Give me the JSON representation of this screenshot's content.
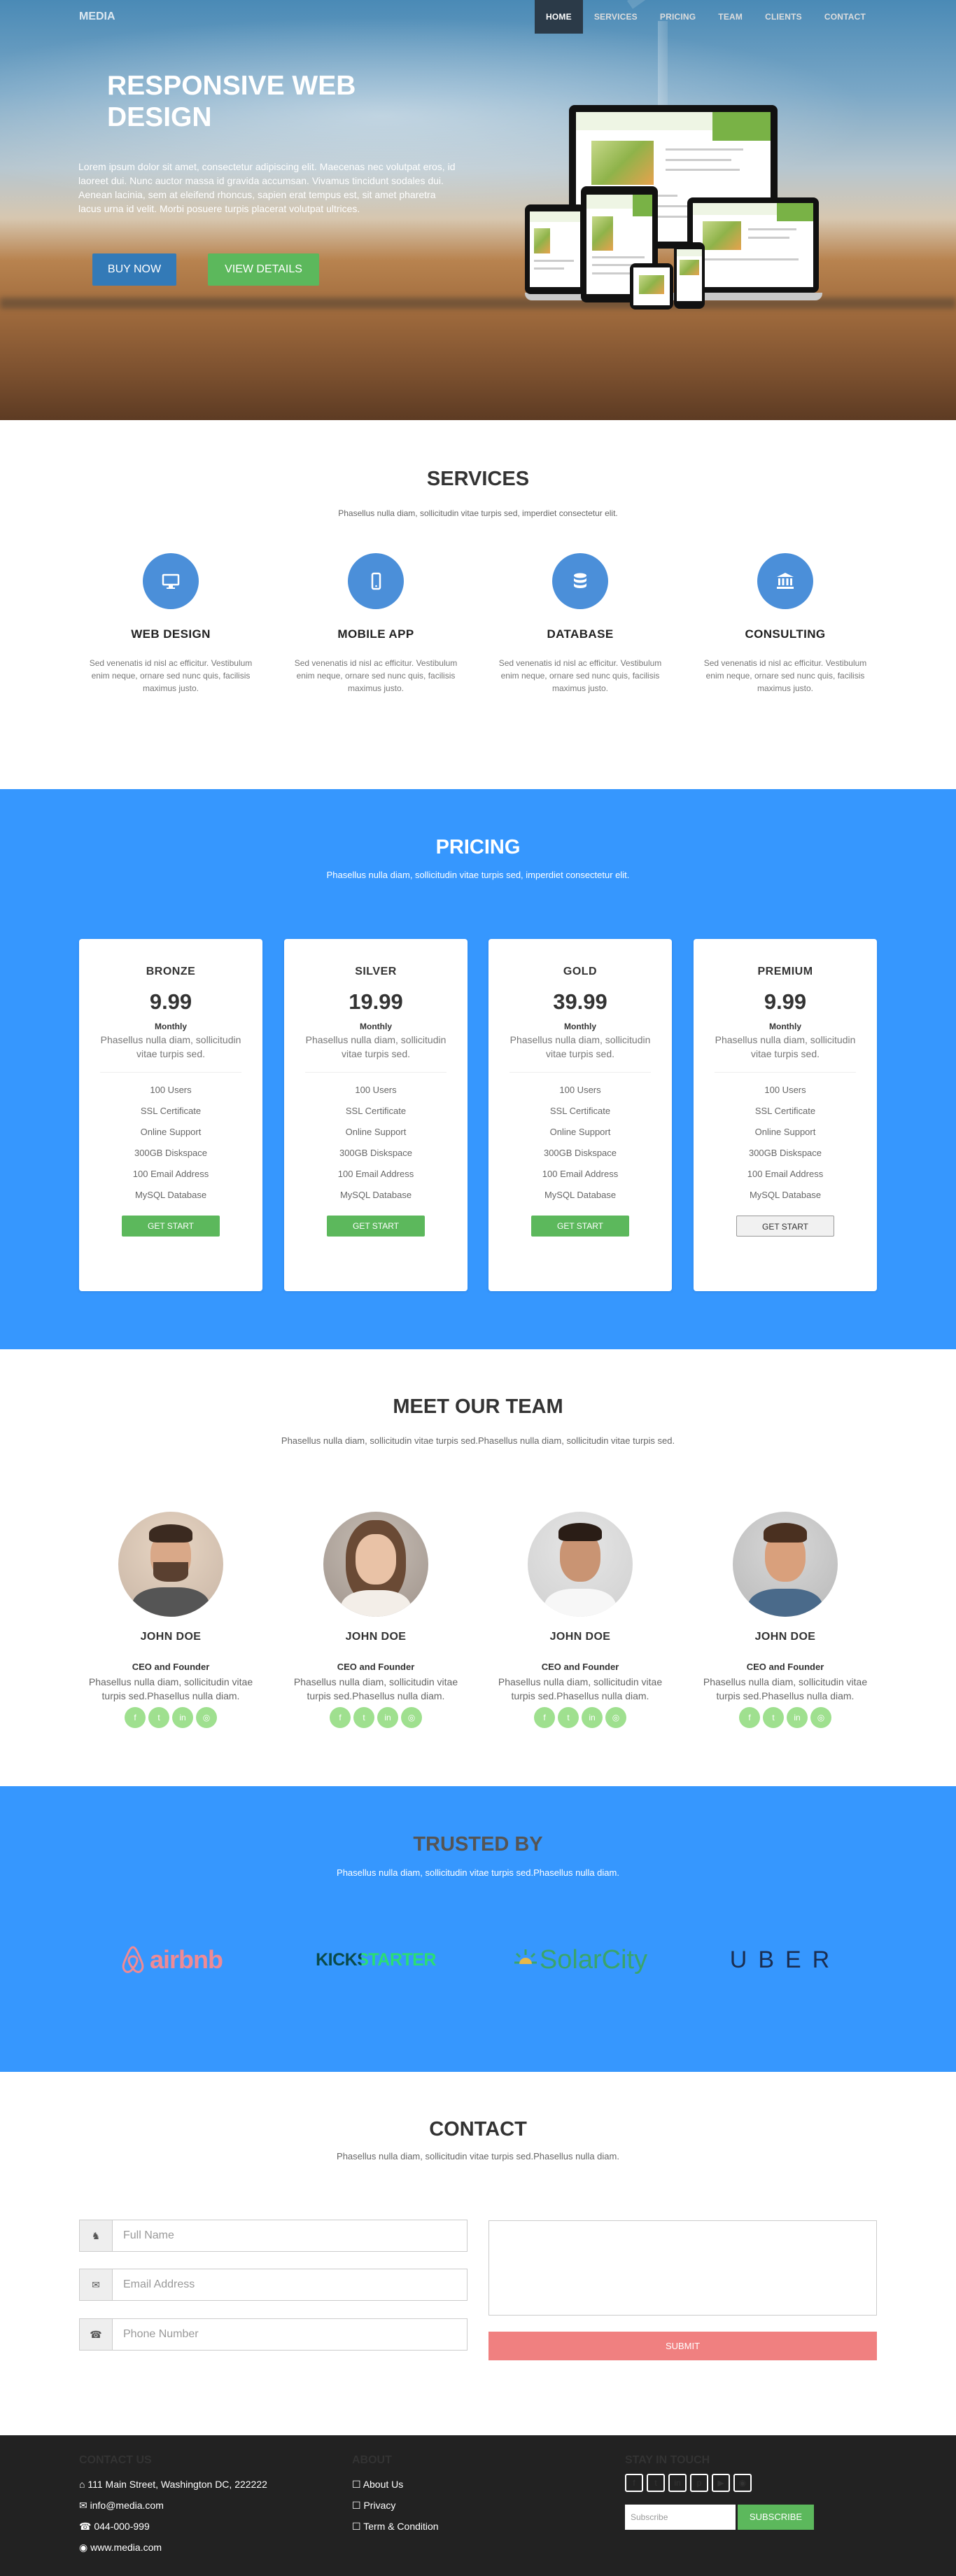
{
  "nav": {
    "brand": "MEDIA",
    "items": [
      "HOME",
      "SERVICES",
      "PRICING",
      "TEAM",
      "CLIENTS",
      "CONTACT"
    ]
  },
  "hero": {
    "title": "RESPONSIVE WEB DESIGN",
    "text": "Lorem ipsum dolor sit amet, consectetur adipiscing elit. Maecenas nec volutpat eros, id laoreet dui. Nunc auctor massa id gravida accumsan. Vivamus tincidunt sodales dui. Aenean lacinia, sem at eleifend rhoncus, sapien erat tempus est, sit amet pharetra lacus urna id velit. Morbi posuere turpis placerat volutpat ultrices.",
    "buy_label": "BUY NOW",
    "view_label": "VIEW DETAILS"
  },
  "services": {
    "title": "SERVICES",
    "subtitle": "Phasellus nulla diam, sollicitudin vitae turpis sed, imperdiet consectetur elit.",
    "items": [
      {
        "icon": "monitor-icon",
        "title": "WEB DESIGN",
        "text": "Sed venenatis id nisl ac efficitur. Vestibulum enim neque, ornare sed nunc quis, facilisis maximus justo."
      },
      {
        "icon": "mobile-icon",
        "title": "MOBILE APP",
        "text": "Sed venenatis id nisl ac efficitur. Vestibulum enim neque, ornare sed nunc quis, facilisis maximus justo."
      },
      {
        "icon": "database-icon",
        "title": "DATABASE",
        "text": "Sed venenatis id nisl ac efficitur. Vestibulum enim neque, ornare sed nunc quis, facilisis maximus justo."
      },
      {
        "icon": "bank-icon",
        "title": "CONSULTING",
        "text": "Sed venenatis id nisl ac efficitur. Vestibulum enim neque, ornare sed nunc quis, facilisis maximus justo."
      }
    ]
  },
  "pricing": {
    "title": "PRICING",
    "subtitle": "Phasellus nulla diam, sollicitudin vitae turpis sed, imperdiet consectetur elit.",
    "plans": [
      {
        "name": "BRONZE",
        "price": "9.99",
        "period": "Monthly",
        "desc": "Phasellus nulla diam, sollicitudin vitae turpis sed.",
        "features": [
          "100 Users",
          "SSL Certificate",
          "Online Support",
          "300GB Diskspace",
          "100 Email Address",
          "MySQL Database"
        ],
        "button": "GET START"
      },
      {
        "name": "SILVER",
        "price": "19.99",
        "period": "Monthly",
        "desc": "Phasellus nulla diam, sollicitudin vitae turpis sed.",
        "features": [
          "100 Users",
          "SSL Certificate",
          "Online Support",
          "300GB Diskspace",
          "100 Email Address",
          "MySQL Database"
        ],
        "button": "GET START"
      },
      {
        "name": "GOLD",
        "price": "39.99",
        "period": "Monthly",
        "desc": "Phasellus nulla diam, sollicitudin vitae turpis sed.",
        "features": [
          "100 Users",
          "SSL Certificate",
          "Online Support",
          "300GB Diskspace",
          "100 Email Address",
          "MySQL Database"
        ],
        "button": "GET START"
      },
      {
        "name": "PREMIUM",
        "price": "9.99",
        "period": "Monthly",
        "desc": "Phasellus nulla diam, sollicitudin vitae turpis sed.",
        "features": [
          "100 Users",
          "SSL Certificate",
          "Online Support",
          "300GB Diskspace",
          "100 Email Address",
          "MySQL Database"
        ],
        "button": "GET START"
      }
    ]
  },
  "team": {
    "title": "MEET OUR TEAM",
    "subtitle": "Phasellus nulla diam, sollicitudin vitae turpis sed.Phasellus nulla diam, sollicitudin vitae turpis sed.",
    "members": [
      {
        "name": "JOHN DOE",
        "role": "CEO and Founder",
        "bio": "Phasellus nulla diam, sollicitudin vitae turpis sed.Phasellus nulla diam."
      },
      {
        "name": "JOHN DOE",
        "role": "CEO and Founder",
        "bio": "Phasellus nulla diam, sollicitudin vitae turpis sed.Phasellus nulla diam."
      },
      {
        "name": "JOHN DOE",
        "role": "CEO and Founder",
        "bio": "Phasellus nulla diam, sollicitudin vitae turpis sed.Phasellus nulla diam."
      },
      {
        "name": "JOHN DOE",
        "role": "CEO and Founder",
        "bio": "Phasellus nulla diam, sollicitudin vitae turpis sed.Phasellus nulla diam."
      }
    ],
    "social_icons": [
      "facebook-icon",
      "twitter-icon",
      "linkedin-icon",
      "dribbble-icon"
    ]
  },
  "trusted": {
    "title": "TRUSTED BY",
    "subtitle": "Phasellus nulla diam, sollicitudin vitae turpis sed.Phasellus nulla diam.",
    "logos": [
      "airbnb",
      "KICKSTARTER",
      "SolarCity",
      "UBER"
    ]
  },
  "contact": {
    "title": "CONTACT",
    "subtitle": "Phasellus nulla diam, sollicitudin vitae turpis sed.Phasellus nulla diam.",
    "name_placeholder": "Full Name",
    "email_placeholder": "Email Address",
    "phone_placeholder": "Phone Number",
    "submit_label": "SUBMIT"
  },
  "footer": {
    "contact_title": "CONTACT US",
    "address": "111 Main Street, Washington DC, 222222",
    "email": "info@media.com",
    "phone": "044-000-999",
    "web": "www.media.com",
    "about_title": "ABOUT",
    "about_links": [
      "About Us",
      "Privacy",
      "Term & Condition"
    ],
    "touch_title": "STAY IN TOUCH",
    "social_icons": [
      "facebook-icon",
      "twitter-icon",
      "linkedin-icon",
      "pinterest-icon",
      "youtube-icon",
      "github-icon"
    ],
    "subscribe_placeholder": "Subscribe",
    "subscribe_label": "SUBSCRIBE"
  },
  "colors": {
    "primary": "#3697fe",
    "nav_active": "#2b3a48",
    "success": "#5cb85c",
    "buy": "#337ab7",
    "submit": "#f08080",
    "footer": "#222222"
  }
}
